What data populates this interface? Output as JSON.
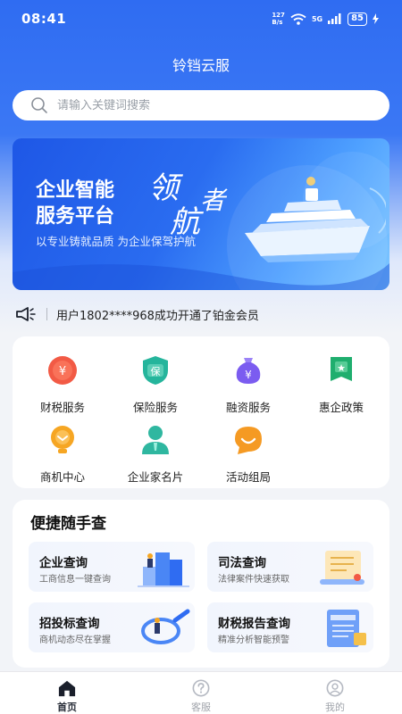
{
  "status_bar": {
    "time": "08:41",
    "net_speed_value": "127",
    "net_speed_unit": "B/s",
    "network": "5G",
    "battery": "85"
  },
  "app": {
    "title": "铃铛云服"
  },
  "search": {
    "placeholder": "请输入关键词搜索"
  },
  "banner": {
    "title_line1": "企业智能",
    "title_line2": "服务平台",
    "slogan": "以专业铸就品质  为企业保驾护航",
    "calligraphy": [
      "领",
      "航",
      "者"
    ]
  },
  "notice": {
    "text": "用户1802****968成功开通了铂金会员"
  },
  "services": [
    {
      "label": "财税服务",
      "icon": "tax-icon",
      "glyph": "¥",
      "color": "#f2553f"
    },
    {
      "label": "保险服务",
      "icon": "insurance-icon",
      "glyph": "保",
      "color": "#22b39a"
    },
    {
      "label": "融资服务",
      "icon": "finance-icon",
      "glyph": "¥",
      "color": "#7b5cf0"
    },
    {
      "label": "惠企政策",
      "icon": "policy-icon",
      "glyph": "★",
      "color": "#1fae6e"
    },
    {
      "label": "商机中心",
      "icon": "business-icon",
      "glyph": "⌄",
      "color": "#f5a623"
    },
    {
      "label": "企业家名片",
      "icon": "card-icon",
      "glyph": "",
      "color": "#2fb7a0"
    },
    {
      "label": "活动组局",
      "icon": "activity-icon",
      "glyph": "",
      "color": "#f59a23"
    }
  ],
  "quick": {
    "title": "便捷随手查",
    "items": [
      {
        "title": "企业查询",
        "subtitle": "工商信息一键查询"
      },
      {
        "title": "司法查询",
        "subtitle": "法律案件快速获取"
      },
      {
        "title": "招投标查询",
        "subtitle": "商机动态尽在掌握"
      },
      {
        "title": "财税报告查询",
        "subtitle": "精准分析智能预警"
      }
    ]
  },
  "tabbar": {
    "items": [
      {
        "label": "首页",
        "icon": "home-icon",
        "active": true
      },
      {
        "label": "客服",
        "icon": "help-icon",
        "active": false
      },
      {
        "label": "我的",
        "icon": "user-icon",
        "active": false
      }
    ]
  },
  "colors": {
    "primary": "#2f6cf2",
    "background": "#f2f4f8"
  }
}
